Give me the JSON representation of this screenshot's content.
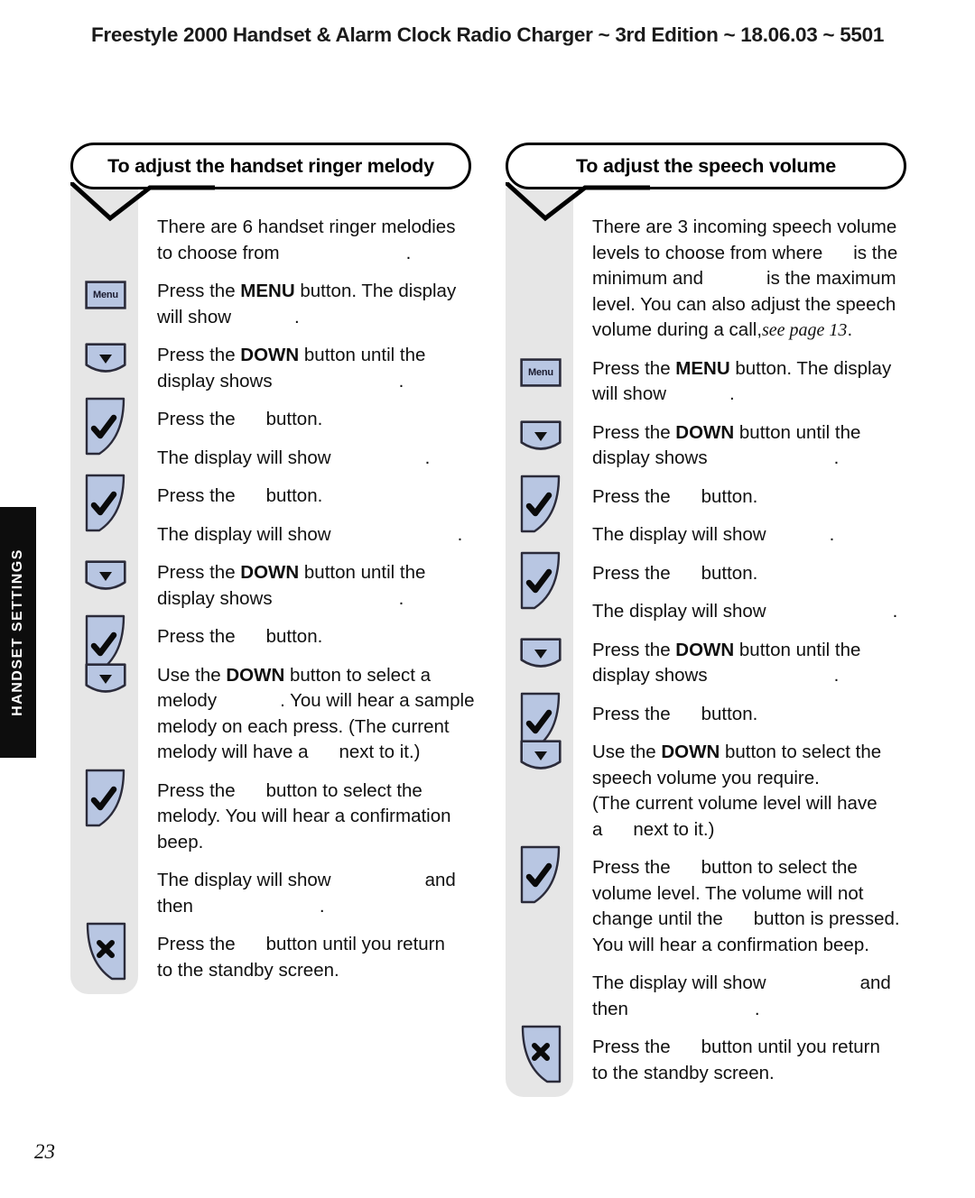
{
  "header": {
    "title": "Freestyle 2000 Handset & Alarm Clock Radio Charger  ~ 3rd Edition ~ 18.06.03 ~ 5501"
  },
  "side_tab": {
    "label": "HANDSET SETTINGS"
  },
  "page_number": "23",
  "icons": {
    "menu_label": "Menu",
    "down_name": "down-arrow-key-icon",
    "ok_name": "tick-key-icon",
    "cancel_name": "cross-key-icon",
    "colors": {
      "key_fill": "#b8c6e2",
      "key_stroke": "#2b2b3a",
      "rail": "#e6e6e6"
    }
  },
  "columns": [
    {
      "title": "To adjust the handset ringer melody",
      "steps": [
        {
          "icon": "none",
          "lines": [
            [
              {
                "t": "text",
                "v": "There are 6 handset ringer melodies"
              }
            ],
            [
              {
                "t": "text",
                "v": "to choose from"
              },
              {
                "t": "gap",
                "v": "xl"
              },
              {
                "t": "text",
                "v": "."
              }
            ]
          ]
        },
        {
          "icon": "menu",
          "lines": [
            [
              {
                "t": "text",
                "v": "Press the"
              },
              {
                "t": "bold",
                "v": " MENU "
              },
              {
                "t": "text",
                "v": "button. The display"
              }
            ],
            [
              {
                "t": "text",
                "v": "will show"
              },
              {
                "t": "gap",
                "v": "m"
              },
              {
                "t": "text",
                "v": "."
              }
            ]
          ]
        },
        {
          "icon": "down",
          "lines": [
            [
              {
                "t": "text",
                "v": "Press the"
              },
              {
                "t": "bold",
                "v": " DOWN "
              },
              {
                "t": "text",
                "v": "button until the"
              }
            ],
            [
              {
                "t": "text",
                "v": "display shows"
              },
              {
                "t": "gap",
                "v": "xl"
              },
              {
                "t": "text",
                "v": "."
              }
            ]
          ]
        },
        {
          "icon": "ok",
          "lines": [
            [
              {
                "t": "text",
                "v": "Press the"
              },
              {
                "t": "gap",
                "v": "s"
              },
              {
                "t": "text",
                "v": "button."
              }
            ]
          ]
        },
        {
          "icon": "none",
          "lines": [
            [
              {
                "t": "text",
                "v": "The display will show"
              },
              {
                "t": "gap",
                "v": "l"
              },
              {
                "t": "text",
                "v": "."
              }
            ]
          ]
        },
        {
          "icon": "ok",
          "lines": [
            [
              {
                "t": "text",
                "v": "Press the"
              },
              {
                "t": "gap",
                "v": "s"
              },
              {
                "t": "text",
                "v": "button."
              }
            ]
          ]
        },
        {
          "icon": "none",
          "lines": [
            [
              {
                "t": "text",
                "v": "The display will show"
              },
              {
                "t": "gap",
                "v": "xl"
              },
              {
                "t": "text",
                "v": "."
              }
            ]
          ]
        },
        {
          "icon": "down",
          "lines": [
            [
              {
                "t": "text",
                "v": "Press the"
              },
              {
                "t": "bold",
                "v": " DOWN "
              },
              {
                "t": "text",
                "v": "button until the"
              }
            ],
            [
              {
                "t": "text",
                "v": "display shows"
              },
              {
                "t": "gap",
                "v": "xl"
              },
              {
                "t": "text",
                "v": "."
              }
            ]
          ]
        },
        {
          "icon": "ok",
          "lines": [
            [
              {
                "t": "text",
                "v": "Press the"
              },
              {
                "t": "gap",
                "v": "s"
              },
              {
                "t": "text",
                "v": "button."
              }
            ]
          ]
        },
        {
          "icon": "down",
          "lines": [
            [
              {
                "t": "text",
                "v": "Use the"
              },
              {
                "t": "bold",
                "v": " DOWN "
              },
              {
                "t": "text",
                "v": "button to select a"
              }
            ],
            [
              {
                "t": "text",
                "v": "melody"
              },
              {
                "t": "gap",
                "v": "m"
              },
              {
                "t": "text",
                "v": ". You will hear a sample"
              }
            ],
            [
              {
                "t": "text",
                "v": "melody on each press. (The current"
              }
            ],
            [
              {
                "t": "text",
                "v": "melody will have a"
              },
              {
                "t": "gap",
                "v": "s"
              },
              {
                "t": "text",
                "v": "next to it.)"
              }
            ]
          ]
        },
        {
          "icon": "ok",
          "lines": [
            [
              {
                "t": "text",
                "v": "Press the"
              },
              {
                "t": "gap",
                "v": "s"
              },
              {
                "t": "text",
                "v": "button to select the"
              }
            ],
            [
              {
                "t": "text",
                "v": "melody. You will hear a confirmation"
              }
            ],
            [
              {
                "t": "text",
                "v": "beep."
              }
            ]
          ]
        },
        {
          "icon": "none",
          "lines": [
            [
              {
                "t": "text",
                "v": "The display will show"
              },
              {
                "t": "gap",
                "v": "l"
              },
              {
                "t": "text",
                "v": "and"
              }
            ],
            [
              {
                "t": "text",
                "v": "then"
              },
              {
                "t": "gap",
                "v": "xl"
              },
              {
                "t": "text",
                "v": "."
              }
            ]
          ]
        },
        {
          "icon": "cancel",
          "lines": [
            [
              {
                "t": "text",
                "v": "Press the"
              },
              {
                "t": "gap",
                "v": "s"
              },
              {
                "t": "text",
                "v": "button until you return"
              }
            ],
            [
              {
                "t": "text",
                "v": "to the standby screen."
              }
            ]
          ]
        }
      ]
    },
    {
      "title": "To adjust the speech volume",
      "steps": [
        {
          "icon": "none",
          "lines": [
            [
              {
                "t": "text",
                "v": "There are 3 incoming speech volume"
              }
            ],
            [
              {
                "t": "text",
                "v": "levels to choose from where"
              },
              {
                "t": "gap",
                "v": "s"
              },
              {
                "t": "text",
                "v": "is the"
              }
            ],
            [
              {
                "t": "text",
                "v": "minimum and"
              },
              {
                "t": "gap",
                "v": "m"
              },
              {
                "t": "text",
                "v": "is the maximum"
              }
            ],
            [
              {
                "t": "text",
                "v": "level. You can also adjust the speech"
              }
            ],
            [
              {
                "t": "text",
                "v": "volume during a call,"
              },
              {
                "t": "ital",
                "v": "see page 13"
              },
              {
                "t": "text",
                "v": "."
              }
            ]
          ]
        },
        {
          "icon": "menu",
          "lines": [
            [
              {
                "t": "text",
                "v": "Press the"
              },
              {
                "t": "bold",
                "v": " MENU "
              },
              {
                "t": "text",
                "v": "button. The display"
              }
            ],
            [
              {
                "t": "text",
                "v": "will show"
              },
              {
                "t": "gap",
                "v": "m"
              },
              {
                "t": "text",
                "v": "."
              }
            ]
          ]
        },
        {
          "icon": "down",
          "lines": [
            [
              {
                "t": "text",
                "v": "Press the"
              },
              {
                "t": "bold",
                "v": " DOWN "
              },
              {
                "t": "text",
                "v": "button until the"
              }
            ],
            [
              {
                "t": "text",
                "v": "display shows"
              },
              {
                "t": "gap",
                "v": "xl"
              },
              {
                "t": "text",
                "v": "."
              }
            ]
          ]
        },
        {
          "icon": "ok",
          "lines": [
            [
              {
                "t": "text",
                "v": "Press the"
              },
              {
                "t": "gap",
                "v": "s"
              },
              {
                "t": "text",
                "v": "button."
              }
            ]
          ]
        },
        {
          "icon": "none",
          "lines": [
            [
              {
                "t": "text",
                "v": "The display will show"
              },
              {
                "t": "gap",
                "v": "m"
              },
              {
                "t": "text",
                "v": "."
              }
            ]
          ]
        },
        {
          "icon": "ok",
          "lines": [
            [
              {
                "t": "text",
                "v": "Press the"
              },
              {
                "t": "gap",
                "v": "s"
              },
              {
                "t": "text",
                "v": "button."
              }
            ]
          ]
        },
        {
          "icon": "none",
          "lines": [
            [
              {
                "t": "text",
                "v": "The display will show"
              },
              {
                "t": "gap",
                "v": "xl"
              },
              {
                "t": "text",
                "v": "."
              }
            ]
          ]
        },
        {
          "icon": "down",
          "lines": [
            [
              {
                "t": "text",
                "v": "Press the"
              },
              {
                "t": "bold",
                "v": " DOWN "
              },
              {
                "t": "text",
                "v": "button until the"
              }
            ],
            [
              {
                "t": "text",
                "v": "display shows"
              },
              {
                "t": "gap",
                "v": "xl"
              },
              {
                "t": "text",
                "v": "."
              }
            ]
          ]
        },
        {
          "icon": "ok",
          "lines": [
            [
              {
                "t": "text",
                "v": "Press the"
              },
              {
                "t": "gap",
                "v": "s"
              },
              {
                "t": "text",
                "v": "button."
              }
            ]
          ]
        },
        {
          "icon": "down",
          "lines": [
            [
              {
                "t": "text",
                "v": "Use the"
              },
              {
                "t": "bold",
                "v": " DOWN "
              },
              {
                "t": "text",
                "v": "button to select the"
              }
            ],
            [
              {
                "t": "text",
                "v": "speech volume you require."
              }
            ],
            [
              {
                "t": "text",
                "v": "(The current volume level will have"
              }
            ],
            [
              {
                "t": "text",
                "v": "a"
              },
              {
                "t": "gap",
                "v": "s"
              },
              {
                "t": "text",
                "v": "next to it.)"
              }
            ]
          ]
        },
        {
          "icon": "ok",
          "lines": [
            [
              {
                "t": "text",
                "v": "Press the"
              },
              {
                "t": "gap",
                "v": "s"
              },
              {
                "t": "text",
                "v": "button to select the"
              }
            ],
            [
              {
                "t": "text",
                "v": "volume level. The volume will not"
              }
            ],
            [
              {
                "t": "text",
                "v": "change until the"
              },
              {
                "t": "gap",
                "v": "s"
              },
              {
                "t": "text",
                "v": "button is pressed."
              }
            ],
            [
              {
                "t": "text",
                "v": "You will hear a confirmation beep."
              }
            ]
          ]
        },
        {
          "icon": "none",
          "lines": [
            [
              {
                "t": "text",
                "v": "The display will show"
              },
              {
                "t": "gap",
                "v": "l"
              },
              {
                "t": "text",
                "v": "and"
              }
            ],
            [
              {
                "t": "text",
                "v": "then"
              },
              {
                "t": "gap",
                "v": "xl"
              },
              {
                "t": "text",
                "v": "."
              }
            ]
          ]
        },
        {
          "icon": "cancel",
          "lines": [
            [
              {
                "t": "text",
                "v": "Press the"
              },
              {
                "t": "gap",
                "v": "s"
              },
              {
                "t": "text",
                "v": "button until you return"
              }
            ],
            [
              {
                "t": "text",
                "v": "to the standby screen."
              }
            ]
          ]
        }
      ]
    }
  ]
}
